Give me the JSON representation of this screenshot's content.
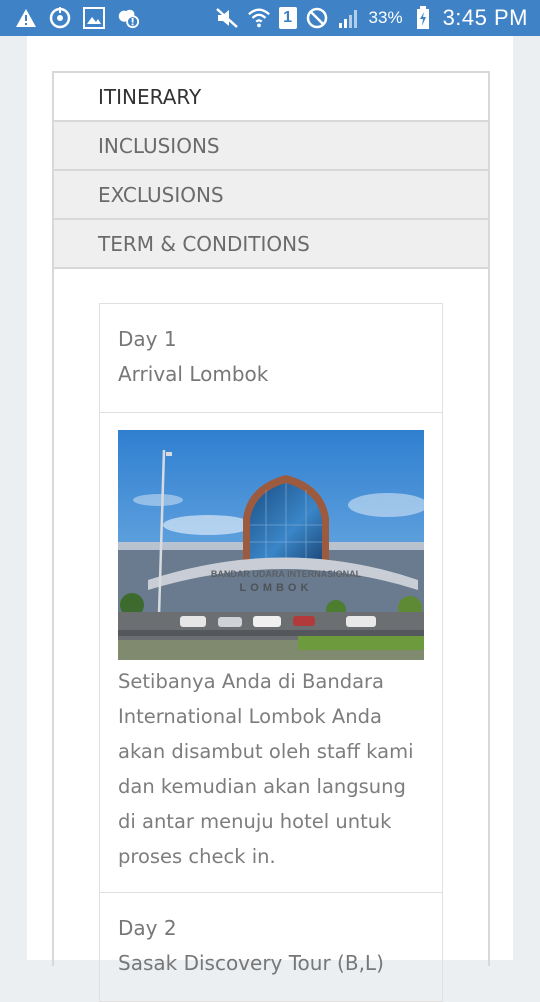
{
  "statusbar": {
    "battery_percent": "33%",
    "sim_slot": "1",
    "time": "3:45 PM"
  },
  "tabs": [
    {
      "label": "ITINERARY",
      "active": true
    },
    {
      "label": "INCLUSIONS",
      "active": false
    },
    {
      "label": "EXCLUSIONS",
      "active": false
    },
    {
      "label": "TERM & CONDITIONS",
      "active": false
    }
  ],
  "itinerary": {
    "days": [
      {
        "day": "Day 1",
        "title": "Arrival Lombok",
        "photo_sign": "BANDAR UDARA INTERNASIONAL",
        "photo_sign2": "LOMBOK",
        "description": "Setibanya Anda di Bandara International Lombok Anda akan disambut oleh staff kami dan kemudian akan langsung di antar menuju hotel untuk proses check in."
      },
      {
        "day": "Day 2",
        "title": "Sasak Discovery Tour (B,L)"
      }
    ]
  },
  "colors": {
    "statusbar": "#3f82c6",
    "background": "#eceff2",
    "text_muted": "#7d7d7d"
  }
}
